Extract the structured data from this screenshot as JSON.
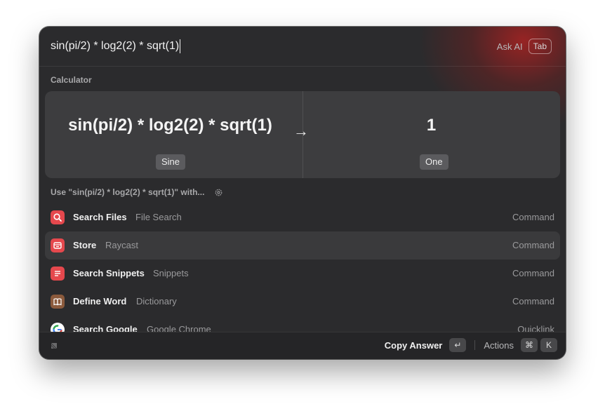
{
  "search": {
    "query": "sin(pi/2) * log2(2) * sqrt(1)"
  },
  "ask_ai": {
    "label": "Ask AI",
    "key": "Tab"
  },
  "calculator": {
    "section_title": "Calculator",
    "expression": "sin(pi/2) * log2(2) * sqrt(1)",
    "expression_tag": "Sine",
    "arrow": "→",
    "result": "1",
    "result_tag": "One"
  },
  "use_with": {
    "label": "Use \"sin(pi/2) * log2(2) * sqrt(1)\" with..."
  },
  "results": [
    {
      "title": "Search Files",
      "subtitle": "File Search",
      "accessory": "Command",
      "icon": "magnifier-icon",
      "color": "#e5484d"
    },
    {
      "title": "Store",
      "subtitle": "Raycast",
      "accessory": "Command",
      "icon": "store-icon",
      "color": "#e5484d"
    },
    {
      "title": "Search Snippets",
      "subtitle": "Snippets",
      "accessory": "Command",
      "icon": "snippets-icon",
      "color": "#e5484d"
    },
    {
      "title": "Define Word",
      "subtitle": "Dictionary",
      "accessory": "Command",
      "icon": "book-icon",
      "color": "#8b5a3c"
    },
    {
      "title": "Search Google",
      "subtitle": "Google Chrome",
      "accessory": "Quicklink",
      "icon": "google-icon",
      "color": "#ffffff"
    }
  ],
  "footer": {
    "primary_action": "Copy Answer",
    "primary_key": "↵",
    "actions_label": "Actions",
    "actions_keys": [
      "⌘",
      "K"
    ]
  },
  "colors": {
    "background": "#2b2b2d",
    "accent": "#e5484d",
    "card": "#3d3d3f"
  }
}
